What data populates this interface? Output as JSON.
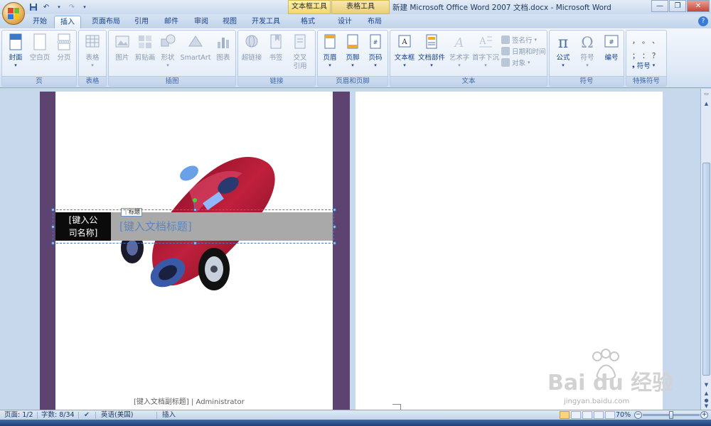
{
  "window": {
    "title": "新建 Microsoft Office Word 2007 文档.docx - Microsoft Word",
    "context_tabs": [
      "文本框工具",
      "表格工具"
    ]
  },
  "tabs": [
    {
      "label": "开始",
      "active": false
    },
    {
      "label": "插入",
      "active": true
    },
    {
      "label": "页面布局",
      "active": false
    },
    {
      "label": "引用",
      "active": false
    },
    {
      "label": "邮件",
      "active": false
    },
    {
      "label": "审阅",
      "active": false
    },
    {
      "label": "视图",
      "active": false
    },
    {
      "label": "开发工具",
      "active": false
    },
    {
      "label": "格式",
      "active": false
    },
    {
      "label": "设计",
      "active": false
    },
    {
      "label": "布局",
      "active": false
    }
  ],
  "ribbon": {
    "groups": {
      "page": "页",
      "table": "表格",
      "illustrations": "插图",
      "links": "链接",
      "header_footer": "页眉和页脚",
      "text": "文本",
      "symbols": "符号",
      "special_symbols": "特殊符号"
    },
    "buttons": {
      "cover": "封面",
      "blank_page": "空白页",
      "page_break": "分页",
      "table": "表格",
      "picture": "图片",
      "clipart": "剪贴画",
      "shapes": "形状",
      "smartart": "SmartArt",
      "chart": "图表",
      "hyperlink": "超链接",
      "bookmark": "书签",
      "cross_ref_1": "交叉",
      "cross_ref_2": "引用",
      "header": "页眉",
      "footer": "页脚",
      "page_number": "页码",
      "textbox": "文本框",
      "quick_parts": "文档部件",
      "wordart": "艺术字",
      "dropcap": "首字下沉",
      "signature_line": "签名行",
      "date_time": "日期和时间",
      "object": "对象",
      "equation": "公式",
      "symbol": "符号",
      "numbering": "编号",
      "special_symbol": "符号"
    },
    "special_chars": [
      "，",
      "。",
      "、",
      "；",
      "：",
      "？"
    ]
  },
  "document": {
    "company_placeholder_line1": "[键入公",
    "company_placeholder_line2": "司名称]",
    "title_tag": "标题",
    "title_placeholder": "[键入文档标题]",
    "subtitle": "[键入文档副标题] | Administrator"
  },
  "statusbar": {
    "page": "页面: 1/2",
    "words": "字数: 8/34",
    "language": "英语(美国)",
    "mode": "插入",
    "zoom": "70%",
    "zoom_fraction": 0.5
  },
  "watermark": {
    "brand_text": "Bai du 经验",
    "url": "jingyan.baidu.com"
  },
  "colors": {
    "accent": "#15428b",
    "page_border": "#5d4470",
    "company_bg": "#0b0b0b",
    "title_bg": "#a9a9a9"
  }
}
